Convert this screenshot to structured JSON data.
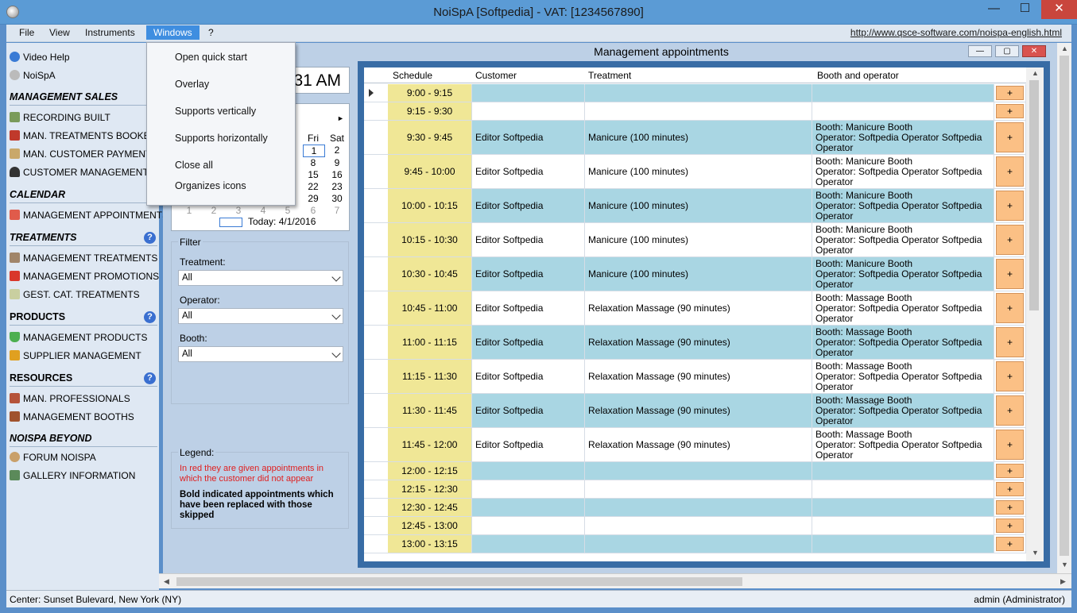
{
  "window": {
    "title": "NoiSpA [Softpedia] - VAT: [1234567890]",
    "min": "—",
    "max": "☐",
    "close": "✕"
  },
  "menubar": {
    "items": [
      "File",
      "View",
      "Instruments",
      "Windows",
      "?"
    ],
    "link": "http://www.qsce-software.com/noispa-english.html"
  },
  "windows_menu": [
    "Open quick start",
    "Overlay",
    "Supports vertically",
    "Supports horizontally",
    "Close all",
    "Organizes icons"
  ],
  "sidebar": {
    "top": [
      {
        "label": "Video Help",
        "icon": "video-icon"
      },
      {
        "label": "NoiSpA",
        "icon": "noispa-icon"
      }
    ],
    "management_sales": {
      "title": "MANAGEMENT SALES",
      "items": [
        "RECORDING BUILT",
        "MAN. TREATMENTS BOOKED",
        "MAN. CUSTOMER PAYMENTS",
        "CUSTOMER MANAGEMENT"
      ]
    },
    "calendar": {
      "title": "CALENDAR",
      "items": [
        "MANAGEMENT APPOINTMENTS"
      ]
    },
    "treatments": {
      "title": "TREATMENTS",
      "help": "?",
      "items": [
        "MANAGEMENT TREATMENTS",
        "MANAGEMENT PROMOTIONS",
        "GEST. CAT. TREATMENTS"
      ]
    },
    "products": {
      "title": "PRODUCTS",
      "help": "?",
      "items": [
        "MANAGEMENT PRODUCTS",
        "SUPPLIER MANAGEMENT"
      ]
    },
    "resources": {
      "title": "RESOURCES",
      "help": "?",
      "items": [
        "MAN. PROFESSIONALS",
        "MANAGEMENT BOOTHS"
      ]
    },
    "beyond": {
      "title": "NOISPA BEYOND",
      "items": [
        "FORUM NOISPA",
        "GALLERY INFORMATION"
      ]
    }
  },
  "clock": "31 AM",
  "calendar": {
    "next": "►",
    "day_headers": [
      "Fri",
      "Sat"
    ],
    "rows": [
      [
        "1",
        "2"
      ],
      [
        "8",
        "9"
      ],
      [
        "15",
        "16"
      ],
      [
        "22",
        "23"
      ],
      [
        "29",
        "30"
      ]
    ],
    "trailing": [
      "1",
      "2",
      "3",
      "4",
      "5",
      "6",
      "7"
    ],
    "today": "Today: 4/1/2016"
  },
  "filter": {
    "title": "Filter",
    "treatment_label": "Treatment:",
    "treatment_value": "All",
    "operator_label": "Operator:",
    "operator_value": "All",
    "booth_label": "Booth:",
    "booth_value": "All"
  },
  "legend": {
    "title": "Legend:",
    "red_text": "In red they are given appointments in which the customer did not appear",
    "bold_text": "Bold indicated appointments which have been replaced with those skipped"
  },
  "mdi": {
    "title": "Management appointments",
    "min": "—",
    "max": "▢",
    "close": "✕"
  },
  "grid": {
    "headers": [
      "Schedule",
      "Customer",
      "Treatment",
      "Booth and operator"
    ],
    "button": "+",
    "rows": [
      {
        "time": "9:00 - 9:15",
        "customer": "",
        "treatment": "",
        "booth": [
          "",
          "",
          ""
        ]
      },
      {
        "time": "9:15 - 9:30",
        "customer": "",
        "treatment": "",
        "booth": [
          "",
          "",
          ""
        ]
      },
      {
        "time": "9:30 - 9:45",
        "customer": "Editor Softpedia",
        "treatment": "Manicure (100 minutes)",
        "booth": [
          "Booth: Manicure Booth",
          "Operator: Softpedia Operator Softpedia",
          "Operator"
        ]
      },
      {
        "time": "9:45 - 10:00",
        "customer": "Editor Softpedia",
        "treatment": "Manicure (100 minutes)",
        "booth": [
          "Booth: Manicure Booth",
          "Operator: Softpedia Operator Softpedia",
          "Operator"
        ]
      },
      {
        "time": "10:00 - 10:15",
        "customer": "Editor Softpedia",
        "treatment": "Manicure (100 minutes)",
        "booth": [
          "Booth: Manicure Booth",
          "Operator: Softpedia Operator Softpedia",
          "Operator"
        ]
      },
      {
        "time": "10:15 - 10:30",
        "customer": "Editor Softpedia",
        "treatment": "Manicure (100 minutes)",
        "booth": [
          "Booth: Manicure Booth",
          "Operator: Softpedia Operator Softpedia",
          "Operator"
        ]
      },
      {
        "time": "10:30 - 10:45",
        "customer": "Editor Softpedia",
        "treatment": "Manicure (100 minutes)",
        "booth": [
          "Booth: Manicure Booth",
          "Operator: Softpedia Operator Softpedia",
          "Operator"
        ]
      },
      {
        "time": "10:45 - 11:00",
        "customer": "Editor Softpedia",
        "treatment": "Relaxation Massage (90 minutes)",
        "booth": [
          "Booth: Massage Booth",
          "Operator: Softpedia Operator Softpedia",
          "Operator"
        ]
      },
      {
        "time": "11:00 - 11:15",
        "customer": "Editor Softpedia",
        "treatment": "Relaxation Massage (90 minutes)",
        "booth": [
          "Booth: Massage Booth",
          "Operator: Softpedia Operator Softpedia",
          "Operator"
        ]
      },
      {
        "time": "11:15 - 11:30",
        "customer": "Editor Softpedia",
        "treatment": "Relaxation Massage (90 minutes)",
        "booth": [
          "Booth: Massage Booth",
          "Operator: Softpedia Operator Softpedia",
          "Operator"
        ]
      },
      {
        "time": "11:30 - 11:45",
        "customer": "Editor Softpedia",
        "treatment": "Relaxation Massage (90 minutes)",
        "booth": [
          "Booth: Massage Booth",
          "Operator: Softpedia Operator Softpedia",
          "Operator"
        ]
      },
      {
        "time": "11:45 - 12:00",
        "customer": "Editor Softpedia",
        "treatment": "Relaxation Massage (90 minutes)",
        "booth": [
          "Booth: Massage Booth",
          "Operator: Softpedia Operator Softpedia",
          "Operator"
        ]
      },
      {
        "time": "12:00 - 12:15",
        "customer": "",
        "treatment": "",
        "booth": [
          "",
          "",
          ""
        ]
      },
      {
        "time": "12:15 - 12:30",
        "customer": "",
        "treatment": "",
        "booth": [
          "",
          "",
          ""
        ]
      },
      {
        "time": "12:30 - 12:45",
        "customer": "",
        "treatment": "",
        "booth": [
          "",
          "",
          ""
        ]
      },
      {
        "time": "12:45 - 13:00",
        "customer": "",
        "treatment": "",
        "booth": [
          "",
          "",
          ""
        ]
      },
      {
        "time": "13:00 - 13:15",
        "customer": "",
        "treatment": "",
        "booth": [
          "",
          "",
          ""
        ]
      }
    ]
  },
  "status": {
    "left": "Center: Sunset Bulevard,  New York (NY)",
    "right": "admin (Administrator)"
  },
  "colors": {
    "schedule": "#f0e796",
    "booked": "#a9d6e3",
    "plus_button": "#fbc085",
    "titlebar": "#5b9bd5"
  }
}
